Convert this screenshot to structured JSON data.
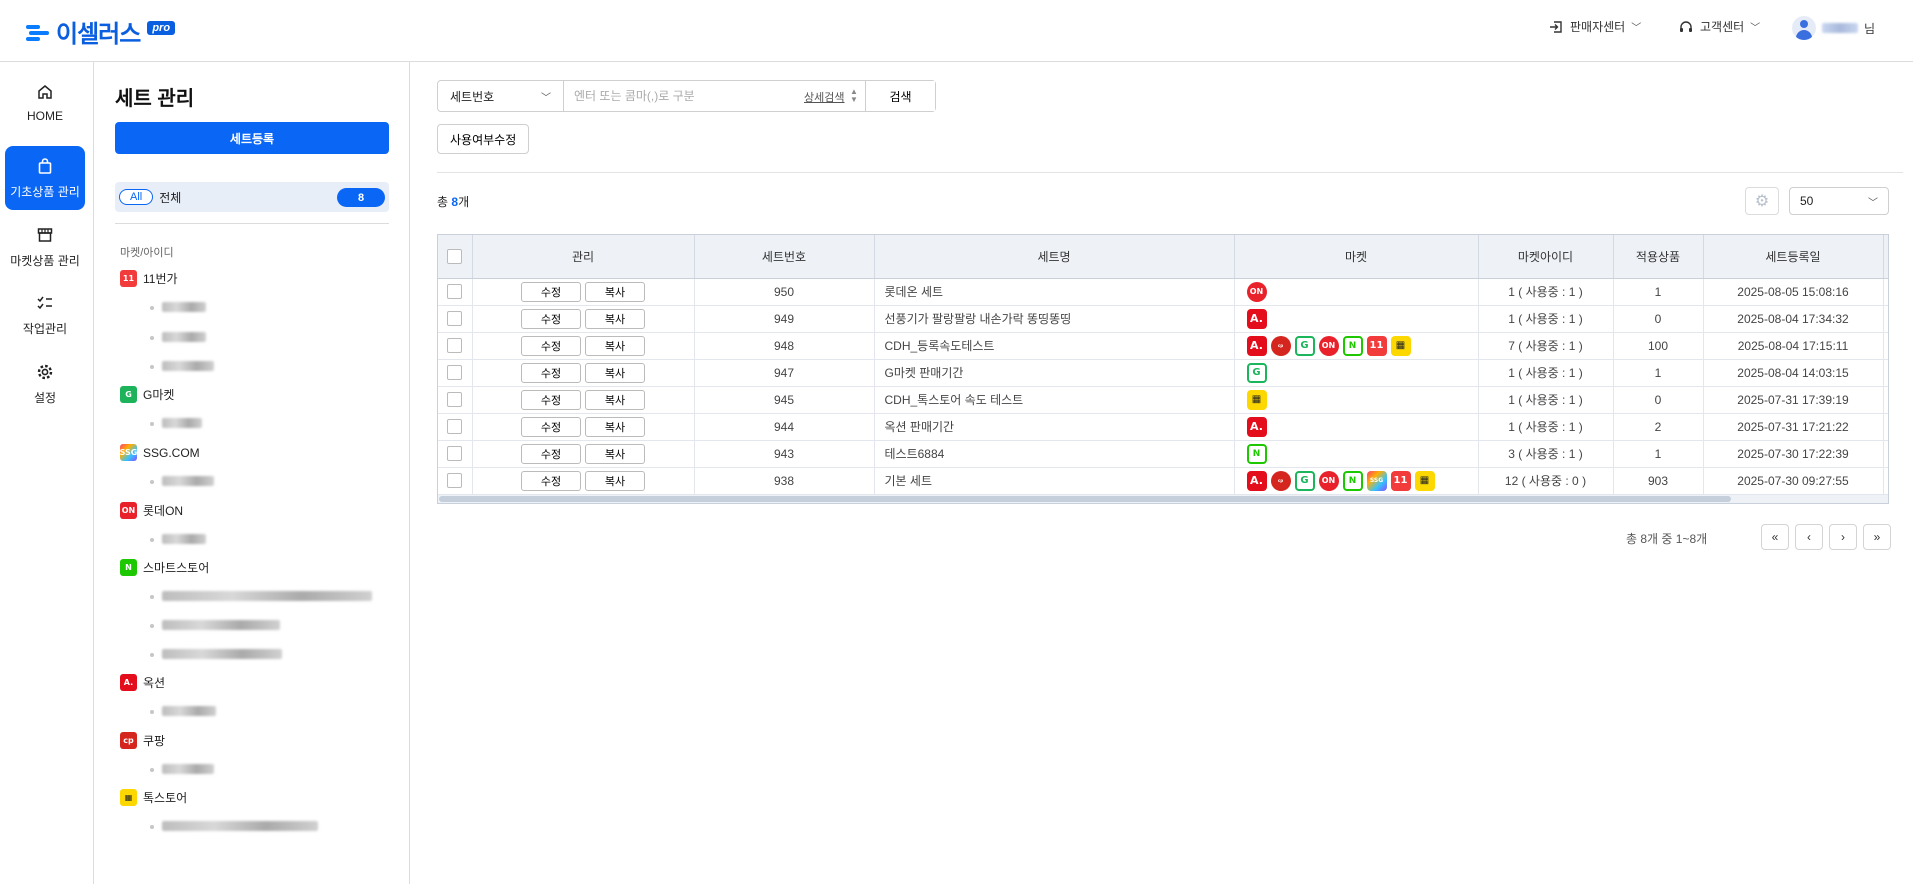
{
  "header": {
    "logo_text": "이셀러스",
    "logo_badge": "pro",
    "seller_center": "판매자센터",
    "customer_center": "고객센터",
    "user_suffix": "님"
  },
  "nav": [
    {
      "label": "HOME",
      "icon": "home-icon",
      "glyph": "⌂",
      "active": false
    },
    {
      "label": "기초상품 관리",
      "icon": "shopping-bag-icon",
      "glyph": "🛍",
      "active": true
    },
    {
      "label": "마켓상품 관리",
      "icon": "store-icon",
      "glyph": "▦",
      "active": false
    },
    {
      "label": "작업관리",
      "icon": "checklist-icon",
      "glyph": "☰",
      "active": false
    },
    {
      "label": "설정",
      "icon": "gear-icon",
      "glyph": "⚙",
      "active": false
    }
  ],
  "sidebar": {
    "title": "세트 관리",
    "register_button": "세트등록",
    "all_pill": "All",
    "all_label": "전체",
    "all_count": "8",
    "section_label": "마켓/아이디",
    "markets": [
      {
        "name": "11번가",
        "badge": "11"
      },
      {
        "name": "G마켓",
        "badge": "G"
      },
      {
        "name": "SSG.COM",
        "badge": "SSG"
      },
      {
        "name": "롯데ON",
        "badge": "ON"
      },
      {
        "name": "스마트스토어",
        "badge": "N"
      },
      {
        "name": "옥션",
        "badge": "A."
      },
      {
        "name": "쿠팡",
        "badge": "coupang"
      },
      {
        "name": "톡스토어",
        "badge": "톡"
      }
    ]
  },
  "search": {
    "select_value": "세트번호",
    "placeholder": "엔터 또는 콤마(,)로 구분",
    "detail_link": "상세검색",
    "button": "검색"
  },
  "toolbar": {
    "usage_edit_button": "사용여부수정",
    "total_prefix": "총 ",
    "total_count": "8",
    "total_suffix": "개",
    "page_size": "50"
  },
  "table": {
    "headers": [
      "관리",
      "세트번호",
      "세트명",
      "마켓",
      "마켓아이디",
      "적용상품",
      "세트등록일"
    ],
    "edit_label": "수정",
    "copy_label": "복사",
    "rows": [
      {
        "id": "950",
        "name": "롯데온 세트",
        "markets": [
          "on"
        ],
        "market_ids": "1 ( 사용중 : 1 )",
        "products": "1",
        "date": "2025-08-05 15:08:16"
      },
      {
        "id": "949",
        "name": "선풍기가 팔랑팔랑 내손가락 똥띵똥띵",
        "markets": [
          "auc"
        ],
        "market_ids": "1 ( 사용중 : 1 )",
        "products": "0",
        "date": "2025-08-04 17:34:32"
      },
      {
        "id": "948",
        "name": "CDH_등록속도테스트",
        "markets": [
          "auc",
          "cp",
          "g",
          "on",
          "ss",
          "11",
          "tk"
        ],
        "market_ids": "7 ( 사용중 : 1 )",
        "products": "100",
        "date": "2025-08-04 17:15:11"
      },
      {
        "id": "947",
        "name": "G마켓 판매기간",
        "markets": [
          "g"
        ],
        "market_ids": "1 ( 사용중 : 1 )",
        "products": "1",
        "date": "2025-08-04 14:03:15"
      },
      {
        "id": "945",
        "name": "CDH_톡스토어 속도 테스트",
        "markets": [
          "tk"
        ],
        "market_ids": "1 ( 사용중 : 1 )",
        "products": "0",
        "date": "2025-07-31 17:39:19"
      },
      {
        "id": "944",
        "name": "옥션 판매기간",
        "markets": [
          "auc"
        ],
        "market_ids": "1 ( 사용중 : 1 )",
        "products": "2",
        "date": "2025-07-31 17:21:22"
      },
      {
        "id": "943",
        "name": "테스트6884",
        "markets": [
          "ss"
        ],
        "market_ids": "3 ( 사용중 : 1 )",
        "products": "1",
        "date": "2025-07-30 17:22:39"
      },
      {
        "id": "938",
        "name": "기본 세트",
        "markets": [
          "auc",
          "cp",
          "g",
          "on",
          "ss",
          "ssg",
          "11",
          "tk"
        ],
        "market_ids": "12 ( 사용중 : 0 )",
        "products": "903",
        "date": "2025-07-30 09:27:55"
      }
    ]
  },
  "pagination": {
    "info": "총 8개 중 1~8개",
    "first": "«",
    "prev": "‹",
    "next": "›",
    "last": "»"
  }
}
